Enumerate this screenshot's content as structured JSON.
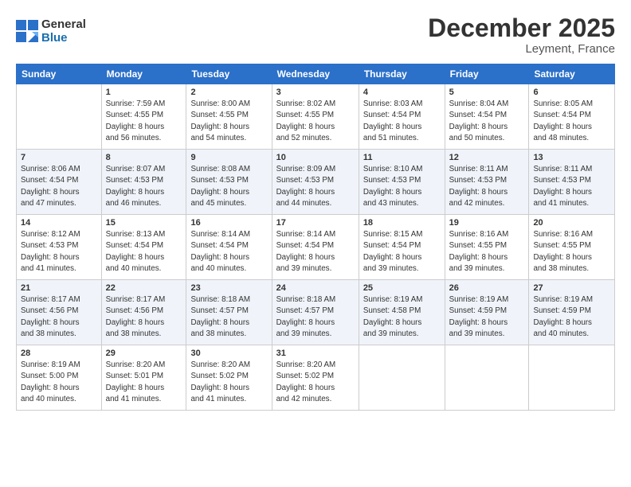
{
  "logo": {
    "line1": "General",
    "line2": "Blue"
  },
  "title": "December 2025",
  "location": "Leyment, France",
  "header_days": [
    "Sunday",
    "Monday",
    "Tuesday",
    "Wednesday",
    "Thursday",
    "Friday",
    "Saturday"
  ],
  "weeks": [
    [
      {
        "day": "",
        "info": ""
      },
      {
        "day": "1",
        "info": "Sunrise: 7:59 AM\nSunset: 4:55 PM\nDaylight: 8 hours\nand 56 minutes."
      },
      {
        "day": "2",
        "info": "Sunrise: 8:00 AM\nSunset: 4:55 PM\nDaylight: 8 hours\nand 54 minutes."
      },
      {
        "day": "3",
        "info": "Sunrise: 8:02 AM\nSunset: 4:55 PM\nDaylight: 8 hours\nand 52 minutes."
      },
      {
        "day": "4",
        "info": "Sunrise: 8:03 AM\nSunset: 4:54 PM\nDaylight: 8 hours\nand 51 minutes."
      },
      {
        "day": "5",
        "info": "Sunrise: 8:04 AM\nSunset: 4:54 PM\nDaylight: 8 hours\nand 50 minutes."
      },
      {
        "day": "6",
        "info": "Sunrise: 8:05 AM\nSunset: 4:54 PM\nDaylight: 8 hours\nand 48 minutes."
      }
    ],
    [
      {
        "day": "7",
        "info": "Sunrise: 8:06 AM\nSunset: 4:54 PM\nDaylight: 8 hours\nand 47 minutes."
      },
      {
        "day": "8",
        "info": "Sunrise: 8:07 AM\nSunset: 4:53 PM\nDaylight: 8 hours\nand 46 minutes."
      },
      {
        "day": "9",
        "info": "Sunrise: 8:08 AM\nSunset: 4:53 PM\nDaylight: 8 hours\nand 45 minutes."
      },
      {
        "day": "10",
        "info": "Sunrise: 8:09 AM\nSunset: 4:53 PM\nDaylight: 8 hours\nand 44 minutes."
      },
      {
        "day": "11",
        "info": "Sunrise: 8:10 AM\nSunset: 4:53 PM\nDaylight: 8 hours\nand 43 minutes."
      },
      {
        "day": "12",
        "info": "Sunrise: 8:11 AM\nSunset: 4:53 PM\nDaylight: 8 hours\nand 42 minutes."
      },
      {
        "day": "13",
        "info": "Sunrise: 8:11 AM\nSunset: 4:53 PM\nDaylight: 8 hours\nand 41 minutes."
      }
    ],
    [
      {
        "day": "14",
        "info": "Sunrise: 8:12 AM\nSunset: 4:53 PM\nDaylight: 8 hours\nand 41 minutes."
      },
      {
        "day": "15",
        "info": "Sunrise: 8:13 AM\nSunset: 4:54 PM\nDaylight: 8 hours\nand 40 minutes."
      },
      {
        "day": "16",
        "info": "Sunrise: 8:14 AM\nSunset: 4:54 PM\nDaylight: 8 hours\nand 40 minutes."
      },
      {
        "day": "17",
        "info": "Sunrise: 8:14 AM\nSunset: 4:54 PM\nDaylight: 8 hours\nand 39 minutes."
      },
      {
        "day": "18",
        "info": "Sunrise: 8:15 AM\nSunset: 4:54 PM\nDaylight: 8 hours\nand 39 minutes."
      },
      {
        "day": "19",
        "info": "Sunrise: 8:16 AM\nSunset: 4:55 PM\nDaylight: 8 hours\nand 39 minutes."
      },
      {
        "day": "20",
        "info": "Sunrise: 8:16 AM\nSunset: 4:55 PM\nDaylight: 8 hours\nand 38 minutes."
      }
    ],
    [
      {
        "day": "21",
        "info": "Sunrise: 8:17 AM\nSunset: 4:56 PM\nDaylight: 8 hours\nand 38 minutes."
      },
      {
        "day": "22",
        "info": "Sunrise: 8:17 AM\nSunset: 4:56 PM\nDaylight: 8 hours\nand 38 minutes."
      },
      {
        "day": "23",
        "info": "Sunrise: 8:18 AM\nSunset: 4:57 PM\nDaylight: 8 hours\nand 38 minutes."
      },
      {
        "day": "24",
        "info": "Sunrise: 8:18 AM\nSunset: 4:57 PM\nDaylight: 8 hours\nand 39 minutes."
      },
      {
        "day": "25",
        "info": "Sunrise: 8:19 AM\nSunset: 4:58 PM\nDaylight: 8 hours\nand 39 minutes."
      },
      {
        "day": "26",
        "info": "Sunrise: 8:19 AM\nSunset: 4:59 PM\nDaylight: 8 hours\nand 39 minutes."
      },
      {
        "day": "27",
        "info": "Sunrise: 8:19 AM\nSunset: 4:59 PM\nDaylight: 8 hours\nand 40 minutes."
      }
    ],
    [
      {
        "day": "28",
        "info": "Sunrise: 8:19 AM\nSunset: 5:00 PM\nDaylight: 8 hours\nand 40 minutes."
      },
      {
        "day": "29",
        "info": "Sunrise: 8:20 AM\nSunset: 5:01 PM\nDaylight: 8 hours\nand 41 minutes."
      },
      {
        "day": "30",
        "info": "Sunrise: 8:20 AM\nSunset: 5:02 PM\nDaylight: 8 hours\nand 41 minutes."
      },
      {
        "day": "31",
        "info": "Sunrise: 8:20 AM\nSunset: 5:02 PM\nDaylight: 8 hours\nand 42 minutes."
      },
      {
        "day": "",
        "info": ""
      },
      {
        "day": "",
        "info": ""
      },
      {
        "day": "",
        "info": ""
      }
    ]
  ]
}
